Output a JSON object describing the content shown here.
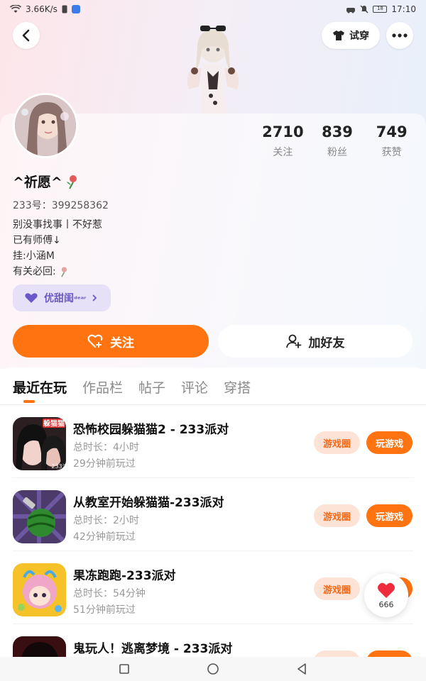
{
  "status_bar": {
    "network_speed": "3.66K/s",
    "time": "17:10",
    "battery": "18",
    "icons": [
      "wifi-icon",
      "sim-icon",
      "app-badge-icon",
      "car-icon",
      "mute-icon",
      "battery-icon"
    ]
  },
  "header": {
    "tryon_label": "试穿",
    "icons": [
      "back-icon",
      "tshirt-icon",
      "more-icon"
    ]
  },
  "profile": {
    "username": "^祈愿^",
    "id_label": "233号：",
    "id_value": "399258362",
    "bio": [
      "别没事找事丨不好惹",
      "已有师傅↓",
      "挂:小涵M",
      "有关必回:"
    ],
    "vip_label": "优甜闺",
    "vip_suffix": "ᵈᵉᵃʳ"
  },
  "stats": [
    {
      "value": "2710",
      "label": "关注"
    },
    {
      "value": "839",
      "label": "粉丝"
    },
    {
      "value": "749",
      "label": "获赞"
    }
  ],
  "actions": {
    "follow_label": "关注",
    "add_friend_label": "加好友"
  },
  "tabs": [
    {
      "label": "最近在玩",
      "active": true
    },
    {
      "label": "作品栏",
      "active": false
    },
    {
      "label": "帖子",
      "active": false
    },
    {
      "label": "评论",
      "active": false
    },
    {
      "label": "穿搭",
      "active": false
    }
  ],
  "games": [
    {
      "title": "恐怖校园躲猫猫2 - 233派对",
      "duration": "总时长：4小时",
      "last_played": "29分钟前玩过",
      "circle_label": "游戏圈",
      "play_label": "玩游戏",
      "icon_badge": "躲猫猫",
      "icon_corner": "233派"
    },
    {
      "title": "从教室开始躲猫猫-233派对",
      "duration": "总时长：2小时",
      "last_played": "42分钟前玩过",
      "circle_label": "游戏圈",
      "play_label": "玩游戏"
    },
    {
      "title": "果冻跑跑-233派对",
      "duration": "总时长：54分钟",
      "last_played": "51分钟前玩过",
      "circle_label": "游戏圈",
      "play_label": "玩游戏"
    },
    {
      "title": "鬼玩人！逃离梦境 - 233派对",
      "circle_label": "游戏圈",
      "play_label": "玩游戏"
    }
  ],
  "like_float": {
    "count": "666"
  },
  "colors": {
    "accent": "#ff7310",
    "vip": "#6a57c9"
  }
}
